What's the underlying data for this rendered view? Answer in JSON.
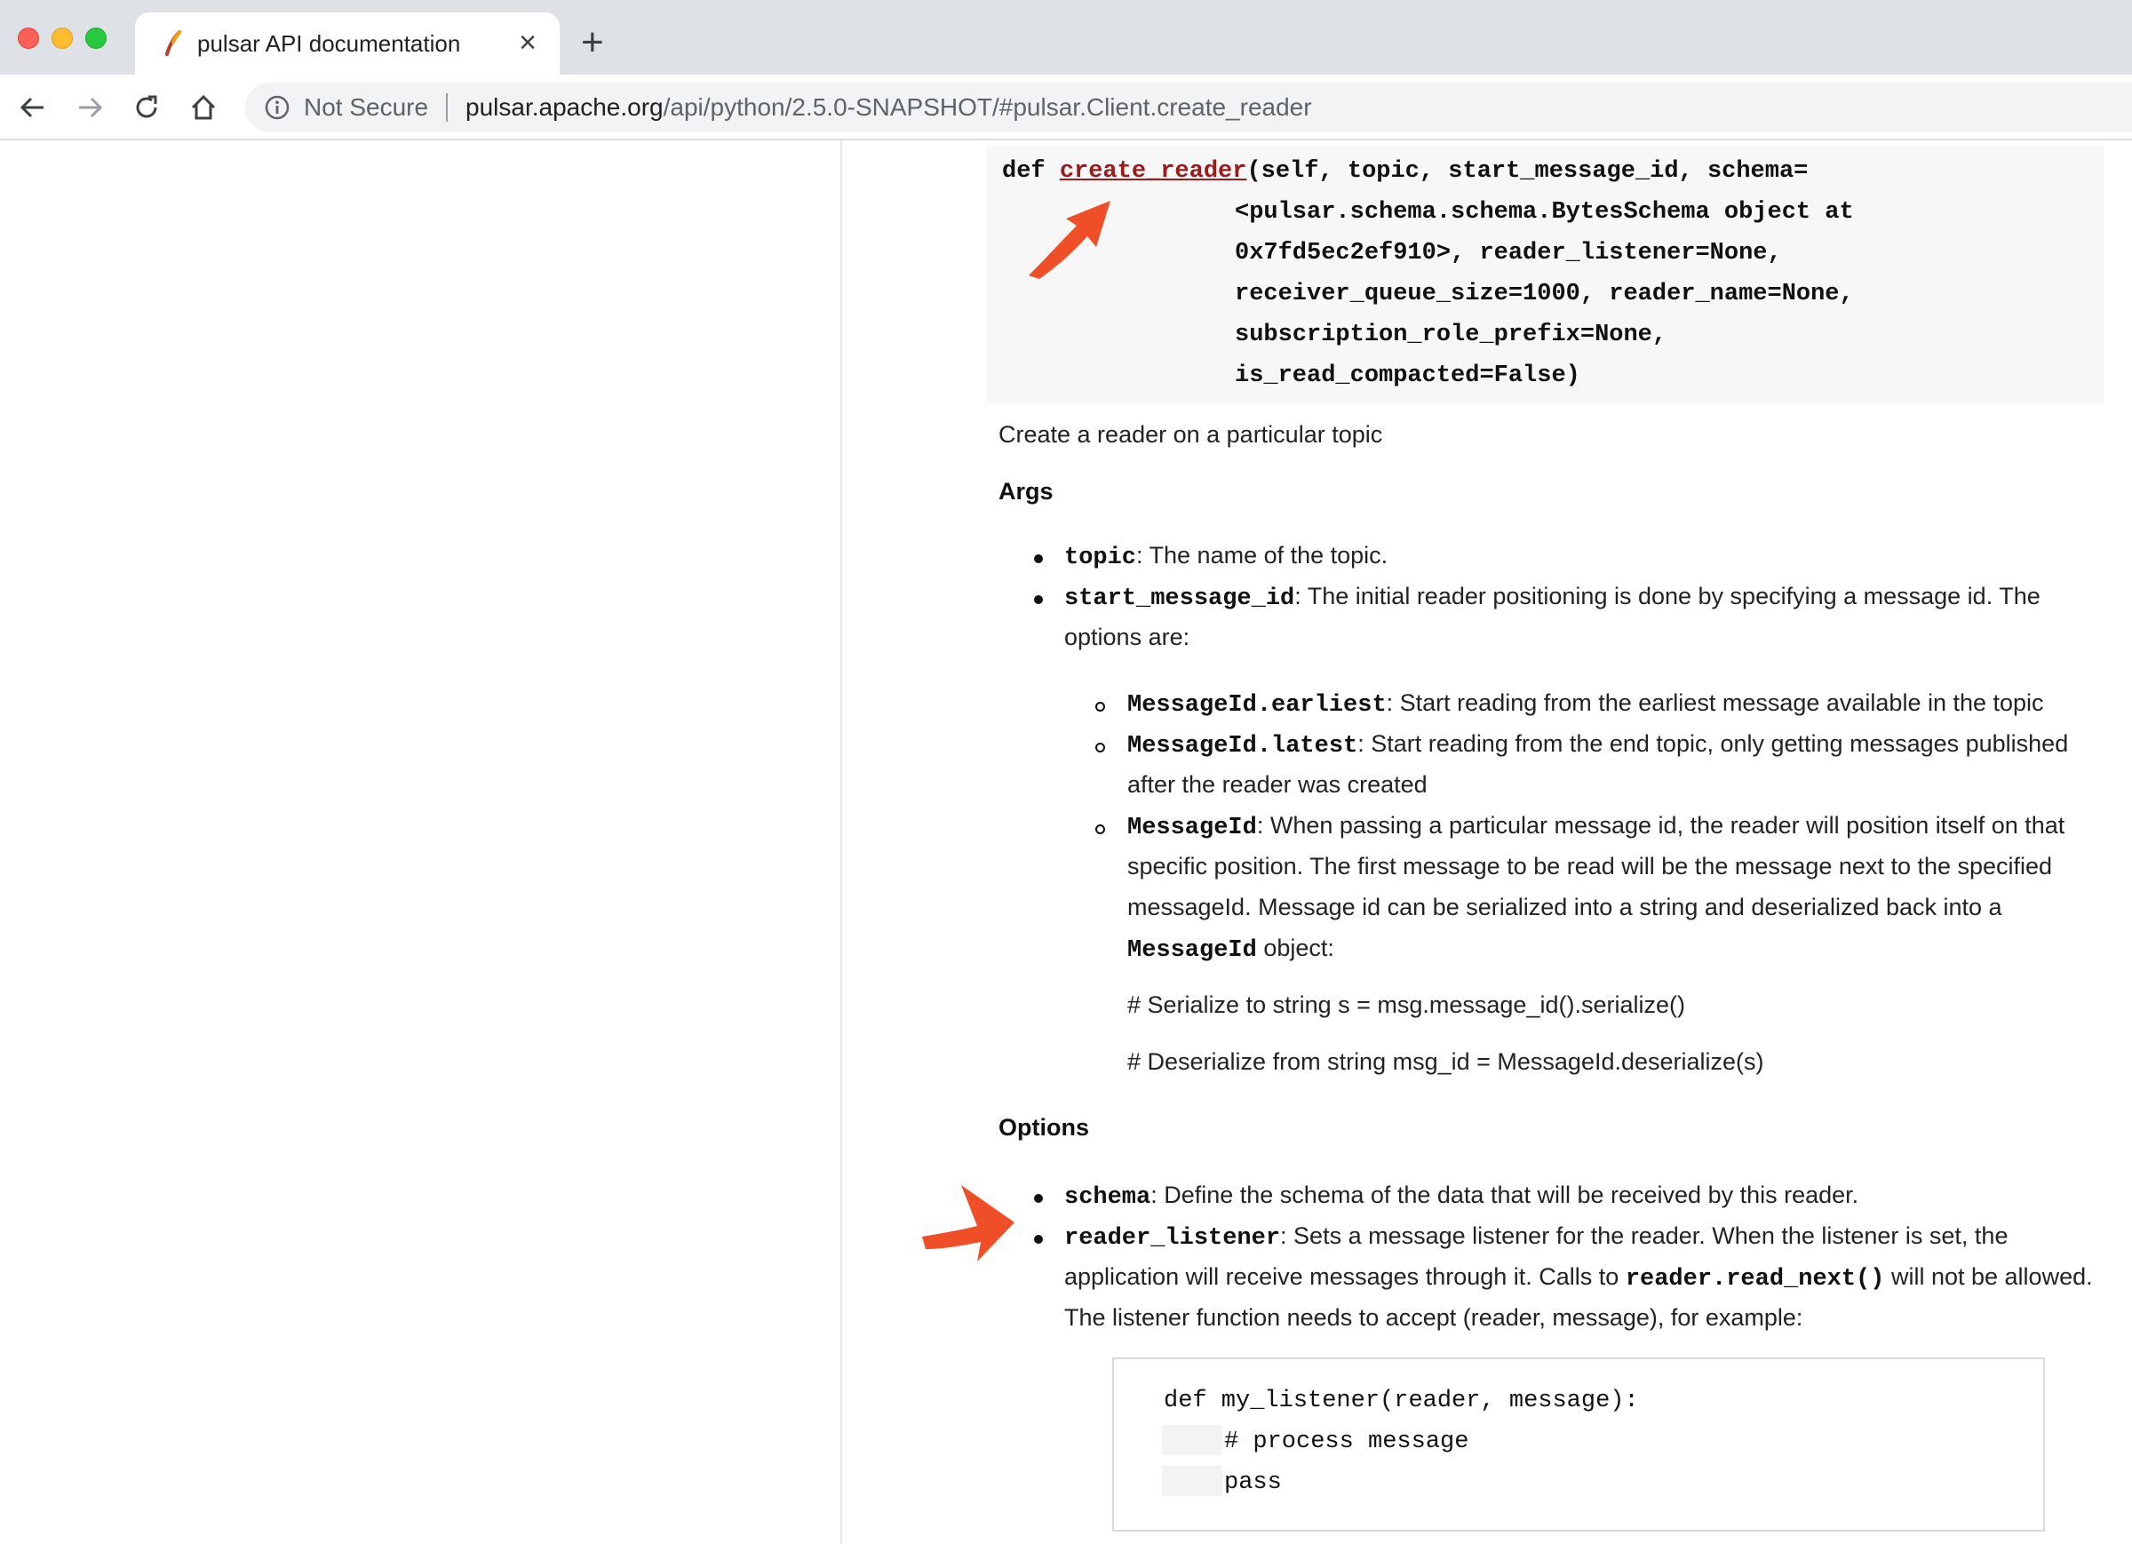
{
  "browser": {
    "tab_title": "pulsar API documentation",
    "tab_close": "×",
    "new_tab": "+",
    "security_label": "Not Secure",
    "url_host": "pulsar.apache.org",
    "url_path": "/api/python/2.5.0-SNAPSHOT/#pulsar.Client.create_reader"
  },
  "signature": {
    "def_kw": "def ",
    "fn_name": "create_reader",
    "line1_rest": "(self, topic, start_message_id, schema=",
    "line2": "<pulsar.schema.schema.BytesSchema object at",
    "line3": "0x7fd5ec2ef910>, reader_listener=None,",
    "line4": "receiver_queue_size=1000, reader_name=None,",
    "line5": "subscription_role_prefix=None,",
    "line6": "is_read_compacted=False)"
  },
  "description": "Create a reader on a particular topic",
  "args": {
    "heading": "Args",
    "topic_code": "topic",
    "topic_text": ": The name of the topic.",
    "smid_code": "start_message_id",
    "smid_text": ": The initial reader positioning is done by specifying a message id. The",
    "smid_text2": "options are:",
    "earliest_code": "MessageId.earliest",
    "earliest_text": ": Start reading from the earliest message available in the topic",
    "latest_code": "MessageId.latest",
    "latest_text": ": Start reading from the end topic, only getting messages published",
    "latest_text2": "after the reader was created",
    "mid_code": "MessageId",
    "mid_text": ": When passing a particular message id, the reader will position itself on that",
    "mid_text2": "specific position. The first message to be read will be the message next to the specified",
    "mid_text3": "messageId. Message id can be serialized into a string and deserialized back into a",
    "mid_code2": "MessageId",
    "mid_text4": " object:",
    "serialize_text": "# Serialize to string s = msg.message_id().serialize()",
    "deserialize_text": "# Deserialize from string msg_id = MessageId.deserialize(s)"
  },
  "options": {
    "heading": "Options",
    "schema_code": "schema",
    "schema_text": ": Define the schema of the data that will be received by this reader.",
    "listener_code": "reader_listener",
    "listener_text": ": Sets a message listener for the reader. When the listener is set, the",
    "listener_text2a": "application will receive messages through it. Calls to ",
    "listener_code2": "reader.read_next()",
    "listener_text2b": " will not be allowed.",
    "listener_text3": "The listener function needs to accept (reader, message), for example:"
  },
  "code_example": {
    "line1": "def my_listener(reader, message):",
    "line2": "# process message",
    "line3": "pass"
  },
  "colors": {
    "accent_arrow": "#ee4f26",
    "function_name": "#9b1b1b"
  }
}
